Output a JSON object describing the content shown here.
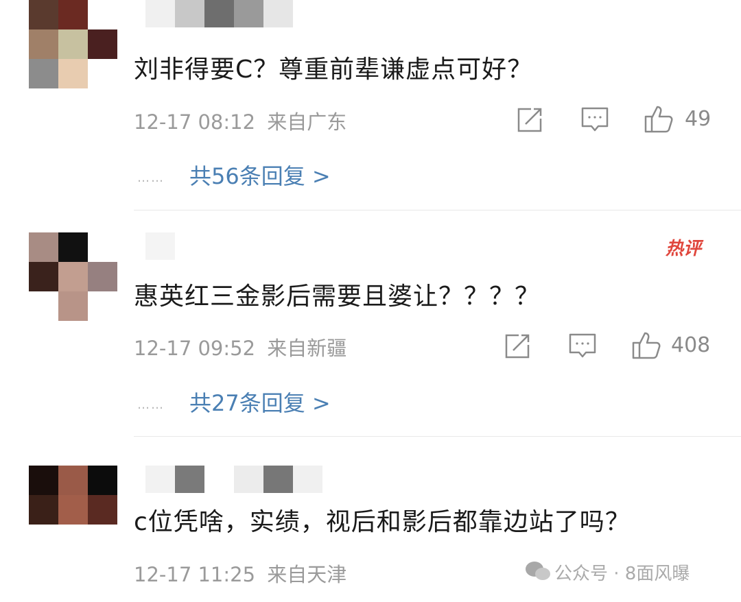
{
  "comments": [
    {
      "text": "刘非得要C？尊重前辈谦虚点可好？",
      "time": "12-17 08:12",
      "location": "来自广东",
      "likes": "49",
      "replies": "共56条回复 >",
      "hot": false
    },
    {
      "text": "惠英红三金影后需要且婆让？？？？",
      "time": "12-17 09:52",
      "location": "来自新疆",
      "likes": "408",
      "replies": "共27条回复 >",
      "hot": true,
      "hot_label": "热评"
    },
    {
      "text": "c位凭啥，实绩，视后和影后都靠边站了吗？",
      "time": "12-17 11:25",
      "location": "来自天津",
      "hot": false
    }
  ],
  "reply_dots": "……",
  "watermark": "公众号 · 8面风曝",
  "colors": {
    "link": "#4a7fb3",
    "meta": "#9a9a9a",
    "hot": "#e0463c"
  },
  "icons": [
    "share-icon",
    "comment-icon",
    "like-icon"
  ]
}
